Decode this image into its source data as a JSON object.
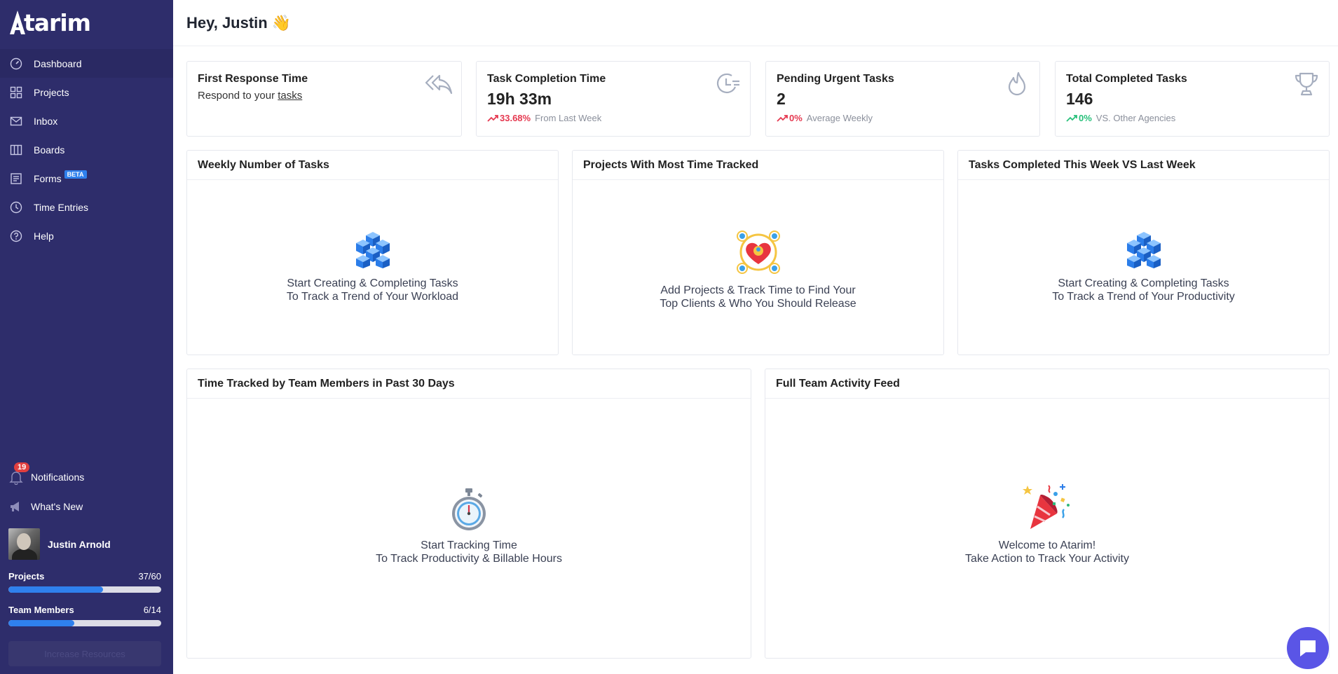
{
  "sidebar": {
    "logo": "tarim",
    "nav": [
      {
        "label": "Dashboard",
        "icon": "dashboard-icon"
      },
      {
        "label": "Projects",
        "icon": "grid-icon"
      },
      {
        "label": "Inbox",
        "icon": "mail-icon"
      },
      {
        "label": "Boards",
        "icon": "board-icon"
      },
      {
        "label": "Forms",
        "icon": "form-icon",
        "badge": "BETA"
      },
      {
        "label": "Time Entries",
        "icon": "clock-icon"
      },
      {
        "label": "Help",
        "icon": "help-icon"
      }
    ],
    "notifications": {
      "label": "Notifications",
      "count": "19"
    },
    "whats_new": "What's New",
    "user_name": "Justin Arnold",
    "usage": [
      {
        "label": "Projects",
        "value": "37/60",
        "fraction": 0.617
      },
      {
        "label": "Team Members",
        "value": "6/14",
        "fraction": 0.43
      }
    ],
    "increase_button": "Increase Resources"
  },
  "header": {
    "greeting": "Hey, Justin",
    "emoji": "👋"
  },
  "stats": [
    {
      "title": "First Response Time",
      "sub_text": "Respond to your ",
      "sub_link": "tasks",
      "icon": "reply-icon"
    },
    {
      "title": "Task Completion Time",
      "value": "19h 33m",
      "pct": "33.68%",
      "note": "From Last Week",
      "trend": "up-red",
      "icon": "clock-history-icon"
    },
    {
      "title": "Pending Urgent Tasks",
      "value": "2",
      "pct": "0%",
      "note": "Average Weekly",
      "trend": "up-red",
      "icon": "flame-icon"
    },
    {
      "title": "Total Completed Tasks",
      "value": "146",
      "pct": "0%",
      "note": "VS. Other Agencies",
      "trend": "up-green",
      "icon": "trophy-icon"
    }
  ],
  "panels": {
    "weekly": {
      "title": "Weekly Number of Tasks",
      "line1": "Start Creating & Completing Tasks",
      "line2": "To Track a Trend of Your Workload"
    },
    "projects": {
      "title": "Projects With Most Time Tracked",
      "line1": "Add Projects & Track Time to Find Your",
      "line2": "Top Clients & Who You Should Release"
    },
    "completed": {
      "title": "Tasks Completed This Week VS Last Week",
      "line1": "Start Creating & Completing Tasks",
      "line2": "To Track a Trend of Your Productivity"
    },
    "time_tracked": {
      "title": "Time Tracked by Team Members in Past 30 Days",
      "line1": "Start Tracking Time",
      "line2": "To Track Productivity & Billable Hours"
    },
    "activity": {
      "title": "Full Team Activity Feed",
      "line1": "Welcome to Atarim!",
      "line2": "Take Action to Track Your Activity"
    }
  },
  "colors": {
    "sidebar": "#2e2d6b",
    "accent": "#2f80ed",
    "trend_red": "#e53950",
    "trend_green": "#27c07a",
    "chat": "#5a55e6"
  }
}
